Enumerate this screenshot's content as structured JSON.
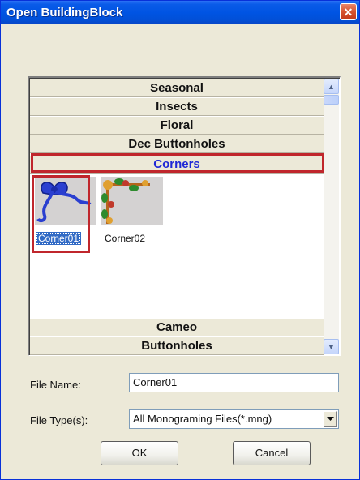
{
  "window": {
    "title": "Open BuildingBlock",
    "close_label": "✕"
  },
  "categories": [
    {
      "label": "Seasonal"
    },
    {
      "label": "Insects"
    },
    {
      "label": "Floral"
    },
    {
      "label": "Dec Buttonholes"
    },
    {
      "label": "Corners",
      "selected": true
    },
    {
      "label": "Cameo"
    },
    {
      "label": "Buttonholes"
    }
  ],
  "items": [
    {
      "label": "Corner01",
      "selected": true
    },
    {
      "label": "Corner02",
      "selected": false
    }
  ],
  "file_name": {
    "label": "File Name:",
    "value": "Corner01"
  },
  "file_type": {
    "label": "File Type(s):",
    "value": "All Monograming Files(*.mng)"
  },
  "buttons": {
    "ok": "OK",
    "cancel": "Cancel"
  },
  "colors": {
    "accent": "#1f28d6",
    "highlight_box": "#c0262c",
    "selection": "#316ac5"
  }
}
